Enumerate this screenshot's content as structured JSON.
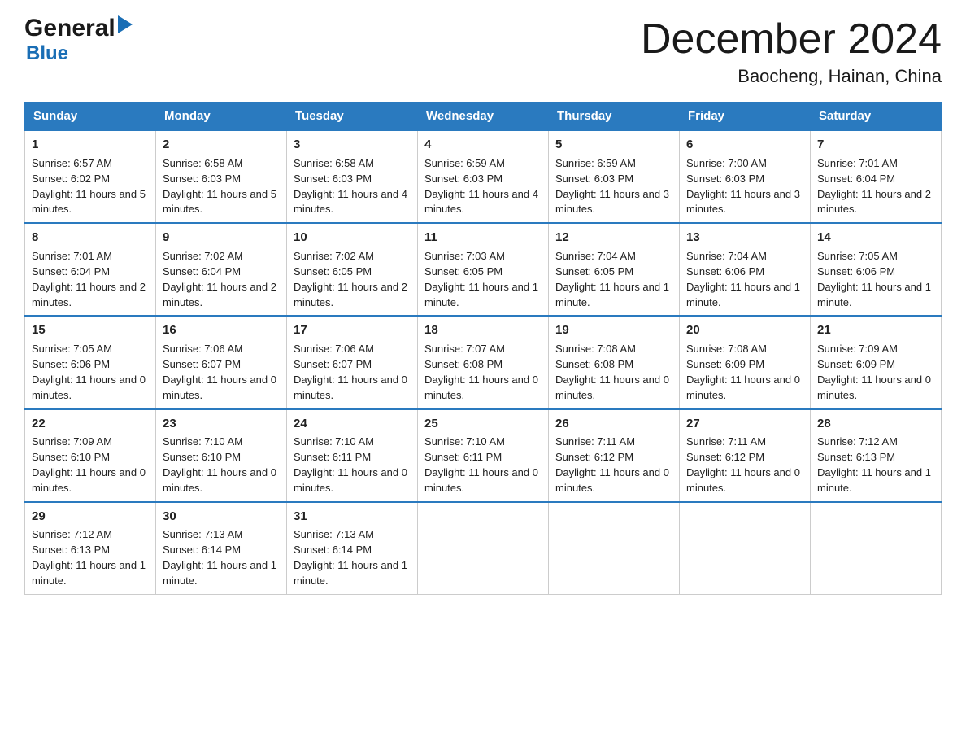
{
  "header": {
    "logo": {
      "general": "General",
      "arrow": "▶",
      "blue": "Blue"
    },
    "month_title": "December 2024",
    "location": "Baocheng, Hainan, China"
  },
  "days_of_week": [
    "Sunday",
    "Monday",
    "Tuesday",
    "Wednesday",
    "Thursday",
    "Friday",
    "Saturday"
  ],
  "weeks": [
    [
      {
        "day": "1",
        "sunrise": "6:57 AM",
        "sunset": "6:02 PM",
        "daylight": "11 hours and 5 minutes."
      },
      {
        "day": "2",
        "sunrise": "6:58 AM",
        "sunset": "6:03 PM",
        "daylight": "11 hours and 5 minutes."
      },
      {
        "day": "3",
        "sunrise": "6:58 AM",
        "sunset": "6:03 PM",
        "daylight": "11 hours and 4 minutes."
      },
      {
        "day": "4",
        "sunrise": "6:59 AM",
        "sunset": "6:03 PM",
        "daylight": "11 hours and 4 minutes."
      },
      {
        "day": "5",
        "sunrise": "6:59 AM",
        "sunset": "6:03 PM",
        "daylight": "11 hours and 3 minutes."
      },
      {
        "day": "6",
        "sunrise": "7:00 AM",
        "sunset": "6:03 PM",
        "daylight": "11 hours and 3 minutes."
      },
      {
        "day": "7",
        "sunrise": "7:01 AM",
        "sunset": "6:04 PM",
        "daylight": "11 hours and 2 minutes."
      }
    ],
    [
      {
        "day": "8",
        "sunrise": "7:01 AM",
        "sunset": "6:04 PM",
        "daylight": "11 hours and 2 minutes."
      },
      {
        "day": "9",
        "sunrise": "7:02 AM",
        "sunset": "6:04 PM",
        "daylight": "11 hours and 2 minutes."
      },
      {
        "day": "10",
        "sunrise": "7:02 AM",
        "sunset": "6:05 PM",
        "daylight": "11 hours and 2 minutes."
      },
      {
        "day": "11",
        "sunrise": "7:03 AM",
        "sunset": "6:05 PM",
        "daylight": "11 hours and 1 minute."
      },
      {
        "day": "12",
        "sunrise": "7:04 AM",
        "sunset": "6:05 PM",
        "daylight": "11 hours and 1 minute."
      },
      {
        "day": "13",
        "sunrise": "7:04 AM",
        "sunset": "6:06 PM",
        "daylight": "11 hours and 1 minute."
      },
      {
        "day": "14",
        "sunrise": "7:05 AM",
        "sunset": "6:06 PM",
        "daylight": "11 hours and 1 minute."
      }
    ],
    [
      {
        "day": "15",
        "sunrise": "7:05 AM",
        "sunset": "6:06 PM",
        "daylight": "11 hours and 0 minutes."
      },
      {
        "day": "16",
        "sunrise": "7:06 AM",
        "sunset": "6:07 PM",
        "daylight": "11 hours and 0 minutes."
      },
      {
        "day": "17",
        "sunrise": "7:06 AM",
        "sunset": "6:07 PM",
        "daylight": "11 hours and 0 minutes."
      },
      {
        "day": "18",
        "sunrise": "7:07 AM",
        "sunset": "6:08 PM",
        "daylight": "11 hours and 0 minutes."
      },
      {
        "day": "19",
        "sunrise": "7:08 AM",
        "sunset": "6:08 PM",
        "daylight": "11 hours and 0 minutes."
      },
      {
        "day": "20",
        "sunrise": "7:08 AM",
        "sunset": "6:09 PM",
        "daylight": "11 hours and 0 minutes."
      },
      {
        "day": "21",
        "sunrise": "7:09 AM",
        "sunset": "6:09 PM",
        "daylight": "11 hours and 0 minutes."
      }
    ],
    [
      {
        "day": "22",
        "sunrise": "7:09 AM",
        "sunset": "6:10 PM",
        "daylight": "11 hours and 0 minutes."
      },
      {
        "day": "23",
        "sunrise": "7:10 AM",
        "sunset": "6:10 PM",
        "daylight": "11 hours and 0 minutes."
      },
      {
        "day": "24",
        "sunrise": "7:10 AM",
        "sunset": "6:11 PM",
        "daylight": "11 hours and 0 minutes."
      },
      {
        "day": "25",
        "sunrise": "7:10 AM",
        "sunset": "6:11 PM",
        "daylight": "11 hours and 0 minutes."
      },
      {
        "day": "26",
        "sunrise": "7:11 AM",
        "sunset": "6:12 PM",
        "daylight": "11 hours and 0 minutes."
      },
      {
        "day": "27",
        "sunrise": "7:11 AM",
        "sunset": "6:12 PM",
        "daylight": "11 hours and 0 minutes."
      },
      {
        "day": "28",
        "sunrise": "7:12 AM",
        "sunset": "6:13 PM",
        "daylight": "11 hours and 1 minute."
      }
    ],
    [
      {
        "day": "29",
        "sunrise": "7:12 AM",
        "sunset": "6:13 PM",
        "daylight": "11 hours and 1 minute."
      },
      {
        "day": "30",
        "sunrise": "7:13 AM",
        "sunset": "6:14 PM",
        "daylight": "11 hours and 1 minute."
      },
      {
        "day": "31",
        "sunrise": "7:13 AM",
        "sunset": "6:14 PM",
        "daylight": "11 hours and 1 minute."
      },
      null,
      null,
      null,
      null
    ]
  ]
}
